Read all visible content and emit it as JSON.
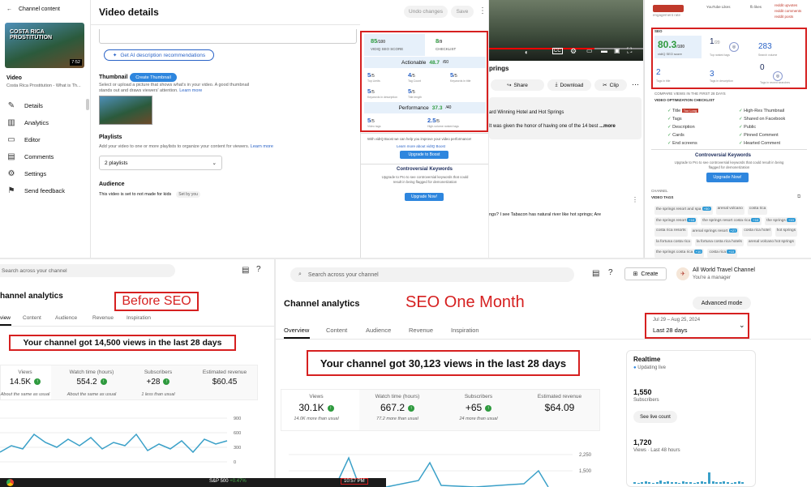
{
  "panel1": {
    "sidebar": {
      "heading": "Channel content",
      "video_label": "Video",
      "video_title": "Costa Rica Prostitution - What is Th...",
      "thumb_text": "COSTA RICA PROSTITUTION",
      "duration": "7:52",
      "items": [
        "Details",
        "Analytics",
        "Editor",
        "Comments",
        "Settings",
        "Send feedback"
      ]
    },
    "header": {
      "title": "Video details",
      "undo": "Undo changes",
      "save": "Save"
    },
    "ai_button": "Get AI description recommendations",
    "thumbnail": {
      "label": "Thumbnail",
      "create": "Create Thumbnail",
      "help": "Select or upload a picture that shows what's in your video. A good thumbnail stands out and draws viewers' attention.",
      "learn": "Learn more"
    },
    "playlists": {
      "label": "Playlists",
      "help": "Add your video to one or more playlists to organize your content for viewers.",
      "learn": "Learn more",
      "value": "2 playlists"
    },
    "audience": {
      "label": "Audience",
      "value": "This video is set to not made for kids",
      "set_by": "Set by you"
    },
    "vidiq": {
      "seo_score": "85",
      "seo_den": "/100",
      "seo_label": "VIDIQ SEO SCORE",
      "checklist": "8",
      "checklist_den": "/9",
      "checklist_label": "CHECKLIST",
      "actionable_label": "Actionable",
      "actionable": "48.7",
      "actionable_den": "/60",
      "cells1": [
        {
          "v": "5",
          "d": "/5",
          "l": "Top Limits"
        },
        {
          "v": "4",
          "d": "/5",
          "l": "Tag Count"
        },
        {
          "v": "5",
          "d": "/5",
          "l": "Keywords in title"
        }
      ],
      "cells2": [
        {
          "v": "5",
          "d": "/5",
          "l": "Keywords in description"
        },
        {
          "v": "5",
          "d": "/5",
          "l": "Title length"
        }
      ],
      "performance_label": "Performance",
      "performance": "37.3",
      "performance_den": "/40",
      "cells3": [
        {
          "v": "5",
          "d": "/5",
          "l": "Video tags"
        },
        {
          "v": "2.5",
          "d": "/5",
          "l": "High-volume ranked tags"
        }
      ],
      "boost_text": "With vidIQ Boost we can help you improve your video performance!",
      "learn_boost": "Learn more about vidIQ Boost",
      "upgrade_boost": "Upgrade to Boost",
      "controversial_title": "Controversial Keywords",
      "controversial_text": "Upgrade to Pro to see controversial keywords that could result in being flagged for demonetization",
      "upgrade_now": "Upgrade Now!"
    }
  },
  "panel2": {
    "title_frag": "prings",
    "share": "Share",
    "download": "Download",
    "clip": "Clip",
    "desc1": "ard Winning Hotel and Hot Springs",
    "desc2": "It was given the honor of having one of the 14 best",
    "more": "...more",
    "comment": "ngs? I see Tabacon has natural river like hot springs; Are"
  },
  "panel3": {
    "top_labels": [
      "engagement rate",
      "YouTube Likes",
      "fb likes",
      "reddit upvotes",
      "reddit comments",
      "reddit posts"
    ],
    "seo_label": "SEO",
    "score": "80.3",
    "score_den": "/100",
    "score_label": "vidIQ SEO score",
    "v1": "1",
    "v1_den": "/20",
    "v1_label": "Top ranked tags",
    "v2": "283",
    "v2_label": "Search volume",
    "v3": "2",
    "v3_label": "Tags in title",
    "v4": "3",
    "v4_label": "Tags in description",
    "v5": "0",
    "v5_label": "Tags in recent searches",
    "compare_label": "COMPARE VIEWS IN THE FIRST 28 DAYS",
    "checklist_label": "VIDEO OPTIMIZATION CHECKLIST",
    "checklist_left": [
      "Title",
      "Tags",
      "Description",
      "Cards",
      "End screens"
    ],
    "title_badge": "Too Long",
    "checklist_right": [
      "High-Res Thumbnail",
      "Shared on Facebook",
      "Public",
      "Pinned Comment",
      "Hearted Comment"
    ],
    "controversial_title": "Controversial Keywords",
    "controversial_text": "Upgrade to Pro to see controversial keywords that could result in being flagged for demonetization",
    "upgrade_now": "Upgrade Now!",
    "channel_label": "CHANNEL",
    "tags_label": "VIDEO TAGS",
    "tags": [
      {
        "t": "the springs resort and spa",
        "b": "+50"
      },
      {
        "t": "arenal volcano",
        "b": ""
      },
      {
        "t": "costa rica",
        "b": ""
      },
      {
        "t": "the springs resort",
        "b": "+10"
      },
      {
        "t": "the springs resort costa rica",
        "b": "+10"
      },
      {
        "t": "the springs",
        "b": "+10"
      },
      {
        "t": "costa rica resorts",
        "b": ""
      },
      {
        "t": "arenal springs resort",
        "b": "+27"
      },
      {
        "t": "costa rica hotel",
        "b": ""
      },
      {
        "t": "hot springs",
        "b": ""
      },
      {
        "t": "la fortuna costa rica",
        "b": ""
      },
      {
        "t": "la fortuna costa rica hotels",
        "b": ""
      },
      {
        "t": "arenal volcano hot springs",
        "b": ""
      },
      {
        "t": "the springs costa rica",
        "b": "+10"
      },
      {
        "t": "costa rica",
        "b": "+10"
      }
    ]
  },
  "panel4": {
    "search_placeholder": "Search across your channel",
    "title": "hannel analytics",
    "label": "Before SEO",
    "tabs": [
      "view",
      "Content",
      "Audience",
      "Revenue",
      "Inspiration"
    ],
    "headline": "Your channel got 14,500 views in the last 28 days",
    "metrics": [
      {
        "l": "Views",
        "v": "14.5K",
        "s": "About the same as usual"
      },
      {
        "l": "Watch time (hours)",
        "v": "554.2",
        "s": "About the same as usual"
      },
      {
        "l": "Subscribers",
        "v": "+28",
        "s": "1 less than usual"
      },
      {
        "l": "Estimated revenue",
        "v": "$60.45",
        "s": ""
      }
    ],
    "yticks": [
      "900",
      "600",
      "300",
      "0"
    ],
    "taskbar": {
      "market": "S&P 500",
      "change": "+0.47%",
      "time": "10:57 PM"
    }
  },
  "panel5": {
    "search_placeholder": "Search across your channel",
    "create": "Create",
    "channel_name": "All World Travel Channel",
    "role": "You're a manager",
    "title": "Channel analytics",
    "label": "SEO One Month",
    "advanced": "Advanced mode",
    "date_range": "Jul 29 – Aug 25, 2024",
    "date_label": "Last 28 days",
    "tabs": [
      "Overview",
      "Content",
      "Audience",
      "Revenue",
      "Inspiration"
    ],
    "headline": "Your channel got 30,123 views in the last 28 days",
    "metrics": [
      {
        "l": "Views",
        "v": "30.1K",
        "s": "14.0K more than usual"
      },
      {
        "l": "Watch time (hours)",
        "v": "667.2",
        "s": "77.2 more than usual"
      },
      {
        "l": "Subscribers",
        "v": "+65",
        "s": "24 more than usual"
      },
      {
        "l": "Estimated revenue",
        "v": "$64.09",
        "s": ""
      }
    ],
    "yticks": [
      "2,250",
      "1,500"
    ],
    "realtime": {
      "title": "Realtime",
      "status": "Updating live",
      "subs": "1,550",
      "subs_label": "Subscribers",
      "live_btn": "See live count",
      "views": "1,720",
      "views_label": "Views · Last 48 hours"
    }
  },
  "colors": {
    "accent_red": "#d62020",
    "vidiq_blue": "#2a63c7",
    "green": "#2e9a3e"
  }
}
